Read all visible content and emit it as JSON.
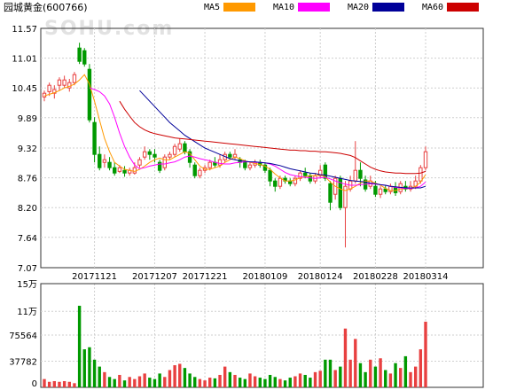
{
  "header": {
    "title": "园城黄金(600766)",
    "watermark": "SOHU.com"
  },
  "legend": [
    {
      "label": "MA5",
      "color": "#ff9900"
    },
    {
      "label": "MA10",
      "color": "#ff00ff"
    },
    {
      "label": "MA20",
      "color": "#000099"
    },
    {
      "label": "MA60",
      "color": "#cc0000"
    }
  ],
  "colors": {
    "up": "#e84040",
    "down": "#009900",
    "grid": "#cfcfcf",
    "axis": "#333333"
  },
  "chart_data": [
    {
      "type": "candlestick",
      "ylim": [
        7.07,
        11.57
      ],
      "yticks": [
        "11.57",
        "11.01",
        "10.45",
        "9.89",
        "9.32",
        "8.76",
        "8.20",
        "7.64",
        "7.07"
      ],
      "xtick_labels": [
        {
          "index": 10,
          "label": "20171121"
        },
        {
          "index": 22,
          "label": "20171207"
        },
        {
          "index": 32,
          "label": "20171221"
        },
        {
          "index": 44,
          "label": "20180109"
        },
        {
          "index": 55,
          "label": "20180124"
        },
        {
          "index": 66,
          "label": "20180228"
        },
        {
          "index": 76,
          "label": "20180314"
        }
      ],
      "candles": [
        [
          10.28,
          10.35,
          10.2,
          10.4
        ],
        [
          10.38,
          10.5,
          10.3,
          10.55
        ],
        [
          10.35,
          10.42,
          10.25,
          10.5
        ],
        [
          10.5,
          10.6,
          10.4,
          10.65
        ],
        [
          10.5,
          10.6,
          10.45,
          10.68
        ],
        [
          10.45,
          10.55,
          10.38,
          10.62
        ],
        [
          10.55,
          10.7,
          10.5,
          10.75
        ],
        [
          11.2,
          10.95,
          10.9,
          11.3
        ],
        [
          11.15,
          10.9,
          10.85,
          11.2
        ],
        [
          10.8,
          9.85,
          9.8,
          10.9
        ],
        [
          9.8,
          9.2,
          9.05,
          9.9
        ],
        [
          9.2,
          8.95,
          8.9,
          9.35
        ],
        [
          9.05,
          9.1,
          8.95,
          9.2
        ],
        [
          9.05,
          8.95,
          8.9,
          9.15
        ],
        [
          8.95,
          8.85,
          8.8,
          9.05
        ],
        [
          8.88,
          8.95,
          8.85,
          9.0
        ],
        [
          8.9,
          8.85,
          8.78,
          8.98
        ],
        [
          8.85,
          8.9,
          8.8,
          8.95
        ],
        [
          8.85,
          8.95,
          8.82,
          9.05
        ],
        [
          9.0,
          9.1,
          8.95,
          9.15
        ],
        [
          9.15,
          9.25,
          9.1,
          9.35
        ],
        [
          9.25,
          9.2,
          9.1,
          9.3
        ],
        [
          9.2,
          9.15,
          9.05,
          9.3
        ],
        [
          9.05,
          8.9,
          8.85,
          9.1
        ],
        [
          8.95,
          9.15,
          8.9,
          9.2
        ],
        [
          9.15,
          9.2,
          9.1,
          9.25
        ],
        [
          9.2,
          9.35,
          9.15,
          9.4
        ],
        [
          9.3,
          9.4,
          9.25,
          9.5
        ],
        [
          9.4,
          9.25,
          9.2,
          9.45
        ],
        [
          9.25,
          9.05,
          8.95,
          9.3
        ],
        [
          9.0,
          8.8,
          8.75,
          9.05
        ],
        [
          8.8,
          8.9,
          8.75,
          8.95
        ],
        [
          8.9,
          8.95,
          8.85,
          9.0
        ],
        [
          8.95,
          9.05,
          8.9,
          9.1
        ],
        [
          9.05,
          9.0,
          8.95,
          9.15
        ],
        [
          9.0,
          9.1,
          8.95,
          9.2
        ],
        [
          9.1,
          9.2,
          9.05,
          9.25
        ],
        [
          9.2,
          9.15,
          9.1,
          9.25
        ],
        [
          9.15,
          9.2,
          9.1,
          9.3
        ],
        [
          9.1,
          9.05,
          8.95,
          9.15
        ],
        [
          9.05,
          8.95,
          8.9,
          9.1
        ],
        [
          8.95,
          9.0,
          8.9,
          9.05
        ],
        [
          9.0,
          9.05,
          8.95,
          9.1
        ],
        [
          9.05,
          9.0,
          8.95,
          9.1
        ],
        [
          9.0,
          8.9,
          8.85,
          9.05
        ],
        [
          8.9,
          8.7,
          8.6,
          8.95
        ],
        [
          8.7,
          8.6,
          8.5,
          8.75
        ],
        [
          8.6,
          8.75,
          8.55,
          8.8
        ],
        [
          8.75,
          8.7,
          8.65,
          8.8
        ],
        [
          8.7,
          8.65,
          8.6,
          8.75
        ],
        [
          8.65,
          8.75,
          8.6,
          8.8
        ],
        [
          8.75,
          8.85,
          8.7,
          8.9
        ],
        [
          8.85,
          8.8,
          8.75,
          8.95
        ],
        [
          8.8,
          8.7,
          8.65,
          8.85
        ],
        [
          8.7,
          8.8,
          8.65,
          8.85
        ],
        [
          8.8,
          8.9,
          8.75,
          9.0
        ],
        [
          9.0,
          8.75,
          8.7,
          9.05
        ],
        [
          8.65,
          8.3,
          8.15,
          8.7
        ],
        [
          8.45,
          8.75,
          8.35,
          8.8
        ],
        [
          8.75,
          8.2,
          8.15,
          8.8
        ],
        [
          8.2,
          8.6,
          7.45,
          8.7
        ],
        [
          8.55,
          8.7,
          8.5,
          8.8
        ],
        [
          8.7,
          8.9,
          8.65,
          9.45
        ],
        [
          8.9,
          8.75,
          8.6,
          9.05
        ],
        [
          8.72,
          8.55,
          8.5,
          8.8
        ],
        [
          8.6,
          8.7,
          8.55,
          8.8
        ],
        [
          8.6,
          8.45,
          8.4,
          8.7
        ],
        [
          8.45,
          8.55,
          8.38,
          8.6
        ],
        [
          8.55,
          8.5,
          8.45,
          8.62
        ],
        [
          8.5,
          8.6,
          8.45,
          8.65
        ],
        [
          8.58,
          8.48,
          8.42,
          8.68
        ],
        [
          8.5,
          8.65,
          8.45,
          8.7
        ],
        [
          8.6,
          8.55,
          8.5,
          8.7
        ],
        [
          8.55,
          8.6,
          8.5,
          8.7
        ],
        [
          8.6,
          8.7,
          8.55,
          8.8
        ],
        [
          8.7,
          8.95,
          8.65,
          9.0
        ],
        [
          8.95,
          9.25,
          8.9,
          9.35
        ]
      ],
      "ma5": [
        10.3,
        10.33,
        10.36,
        10.4,
        10.45,
        10.48,
        10.52,
        10.6,
        10.7,
        10.52,
        10.2,
        9.85,
        9.5,
        9.25,
        9.05,
        8.98,
        8.92,
        8.9,
        8.88,
        8.92,
        8.98,
        9.05,
        9.1,
        9.13,
        9.1,
        9.1,
        9.15,
        9.2,
        9.25,
        9.22,
        9.1,
        8.98,
        8.92,
        8.92,
        8.95,
        8.98,
        9.05,
        9.1,
        9.15,
        9.12,
        9.08,
        9.05,
        9.03,
        9.01,
        8.98,
        8.92,
        8.83,
        8.76,
        8.7,
        8.7,
        8.72,
        8.76,
        8.78,
        8.8,
        8.8,
        8.82,
        8.78,
        8.68,
        8.6,
        8.55,
        8.52,
        8.55,
        8.6,
        8.66,
        8.7,
        8.7,
        8.66,
        8.62,
        8.56,
        8.52,
        8.52,
        8.55,
        8.56,
        8.56,
        8.6,
        8.68,
        8.82
      ],
      "ma10": [
        null,
        null,
        null,
        null,
        null,
        null,
        null,
        null,
        null,
        10.45,
        10.42,
        10.38,
        10.3,
        10.15,
        9.9,
        9.6,
        9.35,
        9.15,
        9.0,
        8.93,
        8.95,
        8.98,
        9.0,
        9.02,
        9.02,
        9.04,
        9.06,
        9.1,
        9.15,
        9.17,
        9.15,
        9.12,
        9.1,
        9.08,
        9.05,
        9.03,
        9.02,
        9.02,
        9.04,
        9.05,
        9.06,
        9.06,
        9.05,
        9.05,
        9.04,
        9.02,
        8.98,
        8.92,
        8.86,
        8.82,
        8.8,
        8.78,
        8.77,
        8.76,
        8.75,
        8.76,
        8.77,
        8.74,
        8.7,
        8.67,
        8.64,
        8.62,
        8.62,
        8.63,
        8.64,
        8.65,
        8.64,
        8.63,
        8.62,
        8.6,
        8.58,
        8.57,
        8.56,
        8.56,
        8.57,
        8.6,
        8.68
      ],
      "ma20": [
        null,
        null,
        null,
        null,
        null,
        null,
        null,
        null,
        null,
        null,
        null,
        null,
        null,
        null,
        null,
        null,
        null,
        null,
        null,
        10.4,
        10.3,
        10.2,
        10.1,
        10.0,
        9.9,
        9.8,
        9.72,
        9.64,
        9.56,
        9.5,
        9.44,
        9.38,
        9.32,
        9.28,
        9.24,
        9.2,
        9.16,
        9.12,
        9.1,
        9.08,
        9.07,
        9.06,
        9.06,
        9.05,
        9.04,
        9.03,
        9.01,
        8.99,
        8.96,
        8.93,
        8.91,
        8.89,
        8.87,
        8.85,
        8.84,
        8.82,
        8.81,
        8.79,
        8.77,
        8.75,
        8.73,
        8.71,
        8.7,
        8.69,
        8.68,
        8.66,
        8.65,
        8.63,
        8.62,
        8.6,
        8.59,
        8.58,
        8.57,
        8.57,
        8.57,
        8.57,
        8.6
      ],
      "ma60": [
        null,
        null,
        null,
        null,
        null,
        null,
        null,
        null,
        null,
        null,
        null,
        null,
        null,
        null,
        null,
        10.2,
        10.05,
        9.92,
        9.8,
        9.72,
        9.66,
        9.62,
        9.59,
        9.57,
        9.55,
        9.53,
        9.51,
        9.5,
        9.49,
        9.48,
        9.47,
        9.46,
        9.45,
        9.44,
        9.43,
        9.42,
        9.41,
        9.4,
        9.39,
        9.38,
        9.37,
        9.36,
        9.35,
        9.34,
        9.33,
        9.32,
        9.31,
        9.3,
        9.29,
        9.28,
        9.28,
        9.27,
        9.27,
        9.26,
        9.26,
        9.25,
        9.25,
        9.24,
        9.23,
        9.22,
        9.2,
        9.18,
        9.14,
        9.08,
        9.02,
        8.96,
        8.92,
        8.89,
        8.87,
        8.86,
        8.85,
        8.85,
        8.84,
        8.84,
        8.84,
        8.85,
        8.88
      ]
    },
    {
      "type": "bar",
      "ylim": [
        0,
        150000
      ],
      "yticks": [
        {
          "value": 150000,
          "label": "15万"
        },
        {
          "value": 110000,
          "label": "11万"
        },
        {
          "value": 75564,
          "label": "75564"
        },
        {
          "value": 37782,
          "label": "37782"
        },
        {
          "value": 0,
          "label": "0"
        }
      ],
      "volume": [
        12000,
        8000,
        9000,
        8000,
        9000,
        8000,
        6000,
        118000,
        55000,
        58000,
        40000,
        30000,
        22000,
        15000,
        12000,
        18000,
        10000,
        15000,
        12000,
        16000,
        20000,
        14000,
        12000,
        20000,
        15000,
        25000,
        32000,
        34000,
        28000,
        20000,
        15000,
        12000,
        10000,
        14000,
        13000,
        18000,
        30000,
        22000,
        18000,
        14000,
        12000,
        20000,
        16000,
        14000,
        12000,
        18000,
        15000,
        12000,
        10000,
        14000,
        16000,
        20000,
        18000,
        14000,
        22000,
        24000,
        40000,
        40000,
        25000,
        30000,
        85000,
        40000,
        70000,
        35000,
        22000,
        40000,
        30000,
        42000,
        25000,
        20000,
        35000,
        28000,
        45000,
        22000,
        30000,
        55000,
        95000
      ]
    }
  ]
}
